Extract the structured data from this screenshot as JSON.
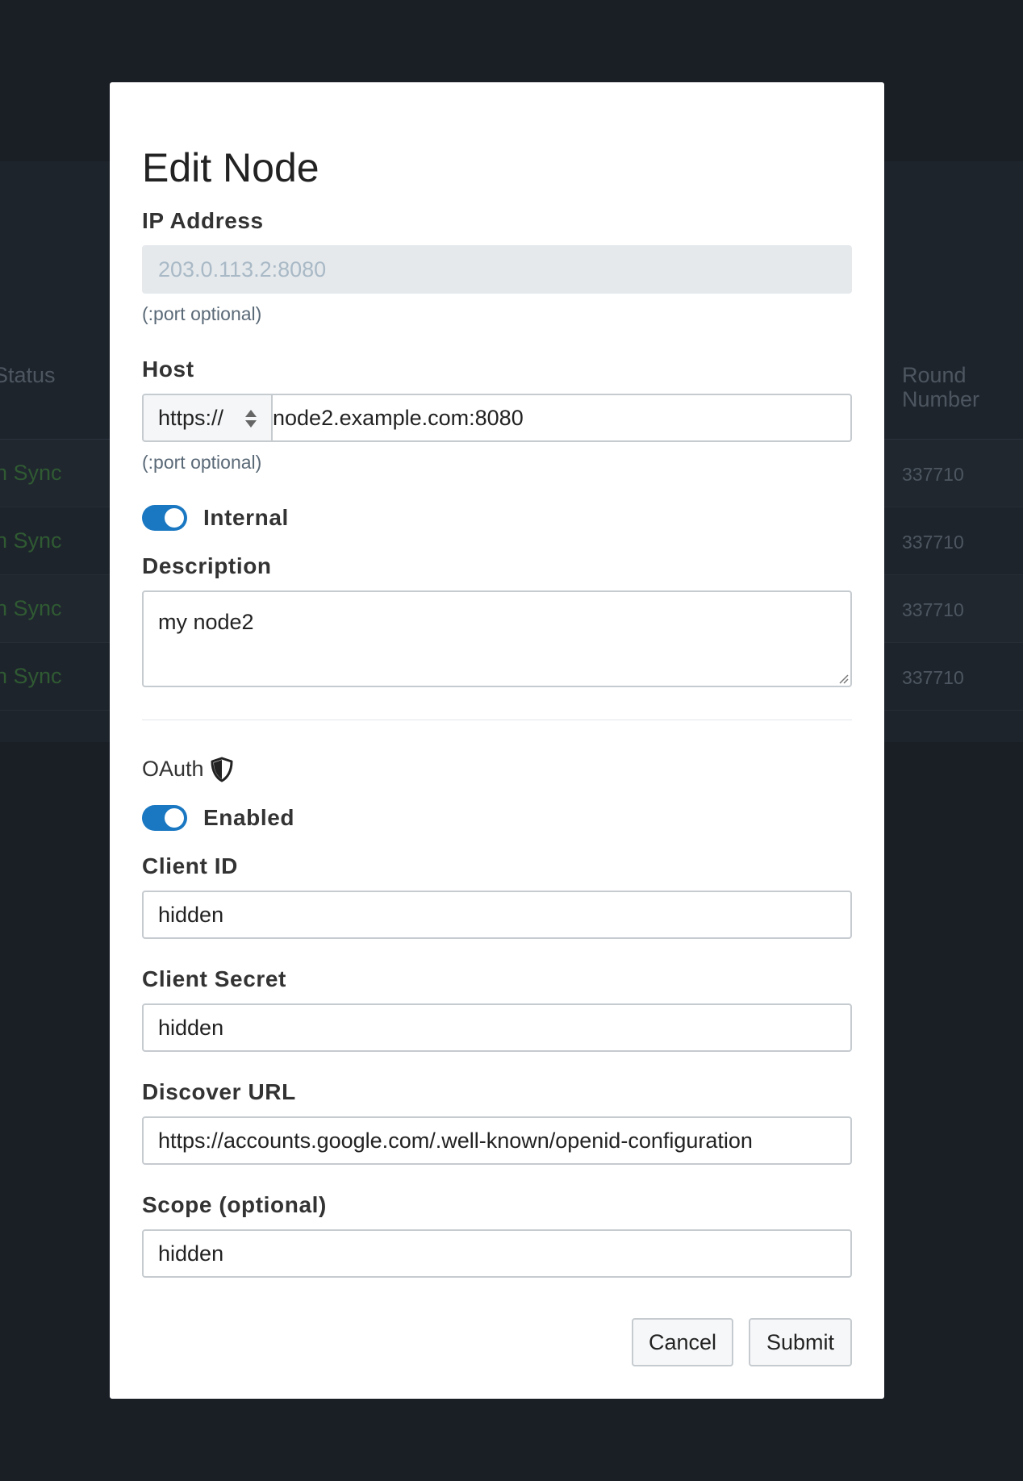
{
  "background": {
    "status_header": "Status",
    "round_header": "Round\nNumber",
    "rows": [
      {
        "status": "n Sync",
        "round": "337710"
      },
      {
        "status": "n Sync",
        "round": "337710"
      },
      {
        "status": "n Sync",
        "round": "337710"
      },
      {
        "status": "n Sync",
        "round": "337710"
      }
    ]
  },
  "modal": {
    "title": "Edit Node",
    "ip_address": {
      "label": "IP Address",
      "placeholder": "203.0.113.2:8080",
      "hint": "(:port optional)"
    },
    "host": {
      "label": "Host",
      "protocol": "https://",
      "value": "node2.example.com:8080",
      "hint": "(:port optional)"
    },
    "internal": {
      "label": "Internal",
      "on": true
    },
    "description": {
      "label": "Description",
      "value": "my node2"
    },
    "oauth": {
      "heading": "OAuth",
      "enabled": {
        "label": "Enabled",
        "on": true
      },
      "client_id": {
        "label": "Client ID",
        "value": "hidden"
      },
      "client_secret": {
        "label": "Client Secret",
        "value": "hidden"
      },
      "discover_url": {
        "label": "Discover URL",
        "value": "https://accounts.google.com/.well-known/openid-configuration"
      },
      "scope": {
        "label": "Scope (optional)",
        "value": "hidden"
      }
    },
    "buttons": {
      "cancel": "Cancel",
      "submit": "Submit"
    }
  },
  "colors": {
    "accent": "#1a78c2",
    "overlay": "#1a1f26",
    "sync_text": "#2f5a32"
  }
}
